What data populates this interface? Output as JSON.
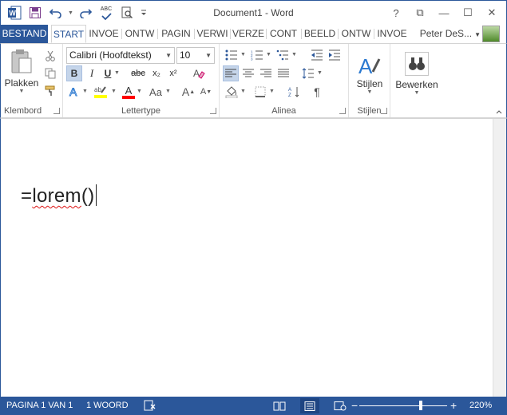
{
  "window": {
    "title": "Document1 - Word",
    "controls": {
      "help": "?",
      "ribbon_display": "⧉",
      "minimize": "—",
      "maximize": "☐",
      "close": "✕"
    }
  },
  "qat": {
    "icons": [
      "word-icon",
      "save-icon",
      "undo-icon",
      "redo-icon",
      "spelling-icon",
      "print-preview-icon",
      "customize-icon"
    ],
    "spelling_label": "ABC"
  },
  "tabs": [
    {
      "label": "BESTAND",
      "kind": "file"
    },
    {
      "label": "START",
      "kind": "active"
    },
    {
      "label": "INVOE",
      "kind": "normal"
    },
    {
      "label": "ONTW",
      "kind": "normal"
    },
    {
      "label": "PAGIN",
      "kind": "normal"
    },
    {
      "label": "VERWI",
      "kind": "normal"
    },
    {
      "label": "VERZE",
      "kind": "normal"
    },
    {
      "label": "CONT",
      "kind": "normal"
    },
    {
      "label": "BEELD",
      "kind": "normal"
    },
    {
      "label": "ONTW",
      "kind": "normal"
    },
    {
      "label": "INVOE",
      "kind": "normal"
    }
  ],
  "user": {
    "name": "Peter DeS..."
  },
  "ribbon": {
    "clipboard": {
      "label": "Klembord",
      "paste_label": "Plakken"
    },
    "font": {
      "label": "Lettertype",
      "font_name": "Calibri (Hoofdtekst)",
      "font_size": "10",
      "bold": "B",
      "italic": "I",
      "underline": "U",
      "strike": "abc",
      "subscript": "x₂",
      "superscript": "x²",
      "grow": "A",
      "shrink": "A",
      "case": "Aa"
    },
    "paragraph": {
      "label": "Alinea",
      "pilcrow": "¶"
    },
    "styles": {
      "label": "Stijlen",
      "button_label": "Stijlen"
    },
    "editing": {
      "label": "Bewerken"
    }
  },
  "document": {
    "text_prefix": "=",
    "text_word": "lorem",
    "text_suffix": "()"
  },
  "status": {
    "page": "PAGINA 1 VAN 1",
    "words": "1 WOORD",
    "zoom_percent": "220%",
    "zoom_fraction": 0.7,
    "zoom_minus": "−",
    "zoom_plus": "+"
  },
  "colors": {
    "accent": "#2b579a",
    "highlight": "#ffff00",
    "font_color": "#ff0000"
  }
}
